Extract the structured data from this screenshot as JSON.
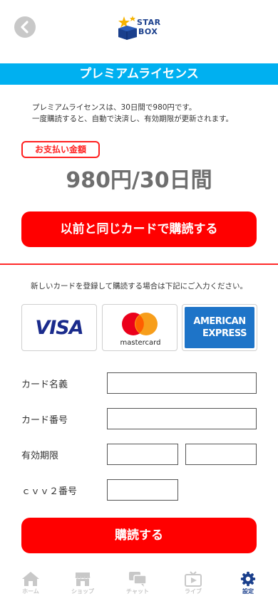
{
  "header": {
    "back_icon": "chevron-left-icon",
    "logo_text_top": "STAR",
    "logo_text_bottom": "BOX"
  },
  "title": "プレミアムライセンス",
  "description": {
    "line1": "プレミアムライセンスは、30日間で980円です。",
    "line2": "一度購読すると、自動で決済し、有効期限が更新されます。"
  },
  "payment": {
    "badge_label": "お支払い金額",
    "amount": "980円/30日間",
    "same_card_button": "以前と同じカードで購読する"
  },
  "new_card": {
    "note": "新しいカードを登録して購読する場合は下記にご入力ください。",
    "brands": {
      "visa": "VISA",
      "mastercard": "mastercard",
      "amex_line1": "AMERICAN",
      "amex_line2": "EXPRESS"
    }
  },
  "form": {
    "card_name_label": "カード名義",
    "card_number_label": "カード番号",
    "expiry_label": "有効期限",
    "cvv_label": "ｃｖｖ２番号",
    "card_name_value": "",
    "card_number_value": "",
    "expiry_month_value": "",
    "expiry_year_value": "",
    "cvv_value": ""
  },
  "purchase_button": "購読する",
  "tabbar": {
    "items": [
      {
        "label": "ホーム",
        "icon": "home-icon",
        "active": false
      },
      {
        "label": "ショップ",
        "icon": "shop-icon",
        "active": false
      },
      {
        "label": "チャット",
        "icon": "chat-icon",
        "active": false
      },
      {
        "label": "ライブ",
        "icon": "live-icon",
        "active": false
      },
      {
        "label": "設定",
        "icon": "gear-icon",
        "active": true
      }
    ]
  },
  "colors": {
    "title_bar": "#00b0f0",
    "accent_red": "#ff0000",
    "brand_navy": "#1a3f8c",
    "tab_inactive": "#c8c8c8"
  }
}
